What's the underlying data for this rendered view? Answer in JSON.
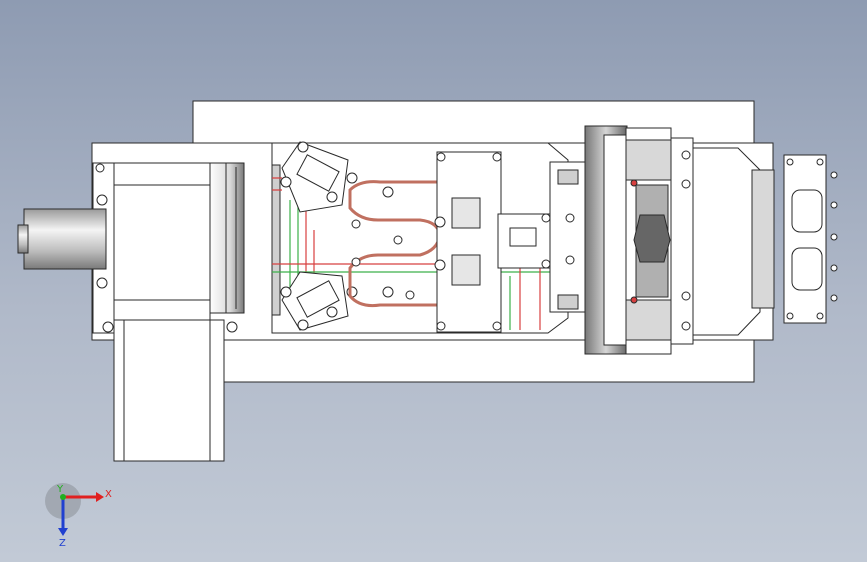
{
  "viewport": {
    "background_top": "#8e9bb2",
    "background_bottom": "#c2cad6"
  },
  "triad": {
    "x_label": "X",
    "y_label": "Y",
    "z_label": "Z",
    "x_color": "#e02020",
    "y_color": "#20b020",
    "z_color": "#2040d0"
  },
  "colors": {
    "part_fill": "#ffffff",
    "edge": "#2a2a2a",
    "shaded_gray": "#cfcfcf",
    "red_line": "#d84040",
    "green_line": "#3cb04a",
    "dark_part": "#555555"
  }
}
